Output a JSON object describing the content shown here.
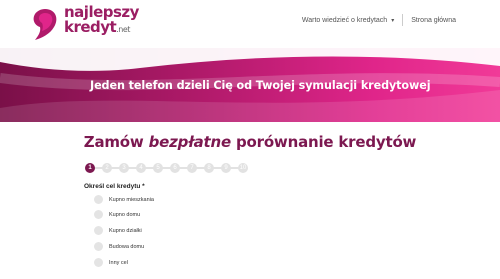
{
  "brand": {
    "line1": "najlepszy",
    "line2": "kredyt",
    "tld": ".net"
  },
  "nav": {
    "items": [
      {
        "label": "Warto wiedzieć o kredytach",
        "has_dropdown": true
      },
      {
        "label": "Strona główna"
      }
    ]
  },
  "banner": {
    "text": "Jeden telefon dzieli Cię od Twojej symulacji kredytowej"
  },
  "form": {
    "title_before": "Zamów ",
    "title_emph": "bezpłatne",
    "title_after": " porównanie kredytów",
    "steps": [
      "1",
      "2",
      "3",
      "4",
      "5",
      "6",
      "7",
      "8",
      "9",
      "10"
    ],
    "active_step": 1,
    "question": "Określ cel kredytu *",
    "options": [
      "Kupno mieszkania",
      "Kupno domu",
      "Kupno działki",
      "Budowa domu",
      "Inny cel"
    ]
  },
  "colors": {
    "brand": "#7c1850",
    "banner_start": "#7a1048",
    "banner_end": "#f13a98"
  },
  "icons": {
    "nav_dropdown": "chevron-down-icon",
    "logo": "brand-logo-icon"
  }
}
